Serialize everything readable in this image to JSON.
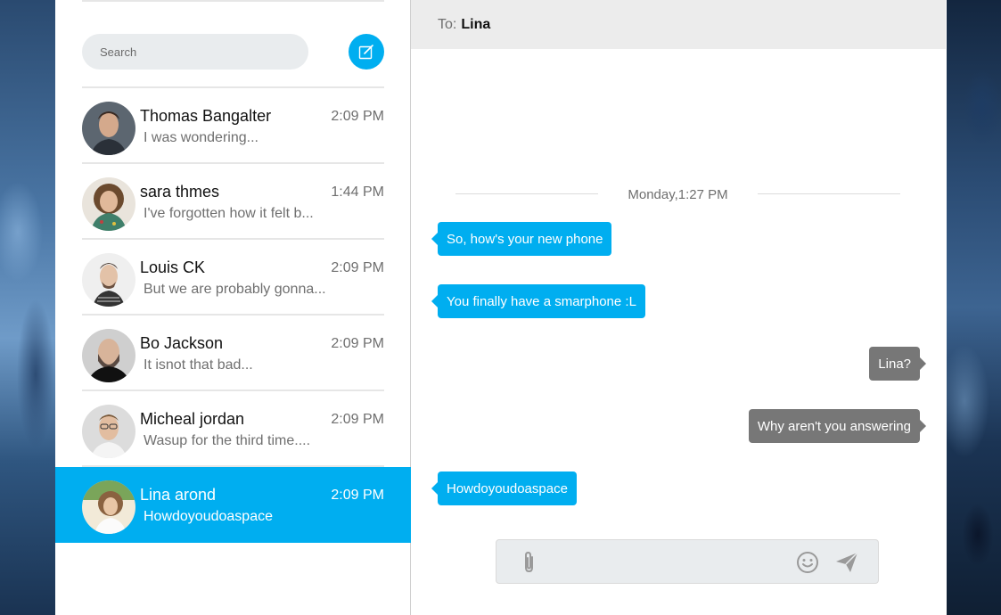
{
  "search": {
    "placeholder": "Search"
  },
  "compose": {
    "icon": "compose-icon"
  },
  "conversations": [
    {
      "name": "Thomas Bangalter",
      "time": "2:09 PM",
      "preview": "I was wondering...",
      "active": false
    },
    {
      "name": "sara thmes",
      "time": "1:44 PM",
      "preview": "I've forgotten how it felt b...",
      "active": false
    },
    {
      "name": "Louis CK",
      "time": "2:09 PM",
      "preview": "But we are probably gonna...",
      "active": false
    },
    {
      "name": "Bo Jackson",
      "time": "2:09 PM",
      "preview": "It isnot that bad...",
      "active": false
    },
    {
      "name": "Micheal jordan",
      "time": "2:09 PM",
      "preview": "Wasup for the third time....",
      "active": false
    },
    {
      "name": "Lina arond",
      "time": "2:09 PM",
      "preview": "Howdoyoudoaspace",
      "active": true
    }
  ],
  "chat": {
    "to_label": "To:",
    "recipient": "Lina",
    "date_divider": "Monday,1:27 PM",
    "messages": [
      {
        "text": "So, how's your new phone",
        "direction": "incoming"
      },
      {
        "text": "You finally have a smarphone :L",
        "direction": "incoming"
      },
      {
        "text": "Lina?",
        "direction": "outgoing"
      },
      {
        "text": "Why aren't you answering",
        "direction": "outgoing"
      },
      {
        "text": "Howdoyoudoaspace",
        "direction": "incoming"
      }
    ],
    "composer": {
      "value": "",
      "placeholder": ""
    }
  },
  "colors": {
    "accent": "#00aef0",
    "outgoing_bubble": "#777777",
    "header_bg": "#ececec",
    "muted_text": "#6f6f6f"
  }
}
